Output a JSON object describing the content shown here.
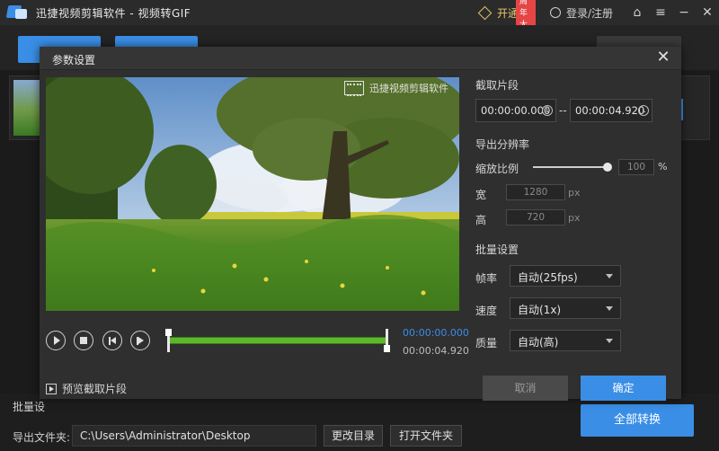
{
  "app": {
    "title": "迅捷视频剪辑软件 - 视频转GIF",
    "vip_label": "开通VIP",
    "vip_badge": "周年大促",
    "login_label": "登录/注册"
  },
  "background": {
    "batch_label": "批量设",
    "output_label": "导出文件夹:",
    "output_path": "C:\\Users\\Administrator\\Desktop",
    "change_dir_button": "更改目录",
    "open_folder_button": "打开文件夹",
    "convert_all_button": "全部转换"
  },
  "dialog": {
    "title": "参数设置",
    "watermark": "迅捷视频剪辑软件",
    "preview_toggle": "预览截取片段",
    "time_start": "00:00:00.000",
    "time_end": "00:00:04.920",
    "clip": {
      "section_title": "截取片段",
      "start": "00:00:00.000",
      "separator": "--",
      "end": "00:00:04.920"
    },
    "resolution": {
      "section_title": "导出分辨率",
      "scale_label": "缩放比例",
      "scale_value": "100",
      "scale_unit": "%",
      "width_label": "宽",
      "width_value": "1280",
      "height_label": "高",
      "height_value": "720",
      "px_unit": "px"
    },
    "batch": {
      "section_title": "批量设置",
      "fps_label": "帧率",
      "fps_value": "自动(25fps)",
      "speed_label": "速度",
      "speed_value": "自动(1x)",
      "quality_label": "质量",
      "quality_value": "自动(高)"
    },
    "cancel_button": "取消",
    "ok_button": "确定"
  },
  "colors": {
    "accent": "#3a8ee6",
    "timeline": "#5cb82a",
    "vip": "#e8c46b"
  }
}
